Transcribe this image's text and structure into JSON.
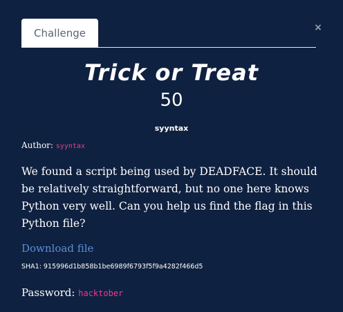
{
  "tab": {
    "label": "Challenge"
  },
  "close_icon": "×",
  "challenge": {
    "title": "Trick or Treat",
    "points": "50",
    "handle": "syyntax",
    "author_label": "Author:",
    "author_name": "syyntax",
    "description": "We found a script being used by DEADFACE. It should be relatively straightforward, but no one here knows Python very well. Can you help us find the flag in this Python file?",
    "download_label": "Download file",
    "sha1": "SHA1: 915996d1b858b1be6989f6793f5f9a4282f466d5",
    "password_label": "Password:",
    "password_value": "hacktober"
  },
  "colors": {
    "background": "#0f2140",
    "accent_pink": "#e83e8c",
    "link_blue": "#5a8fd6"
  }
}
